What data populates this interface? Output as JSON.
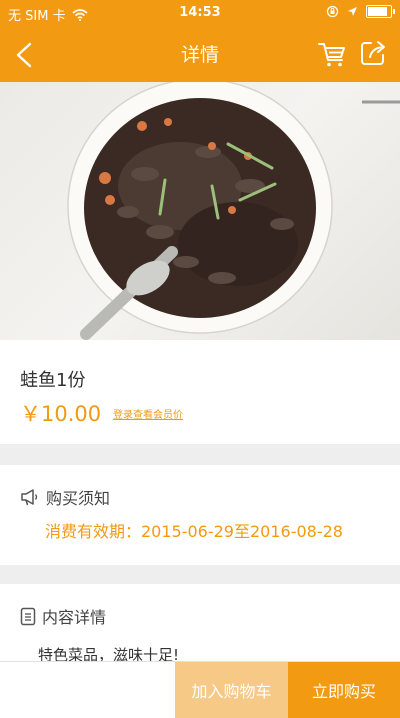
{
  "status_bar": {
    "carrier": "无 SIM 卡",
    "time": "14:53",
    "battery_level": 0.95
  },
  "nav": {
    "title": "详情"
  },
  "product": {
    "name": "蛙鱼1份",
    "price": "￥10.00",
    "member_price_link": "登录查看会员价"
  },
  "purchase_notice": {
    "title": "购买须知",
    "validity": "消费有效期：2015-06-29至2016-08-28"
  },
  "content_detail": {
    "title": "内容详情",
    "text": "特色菜品，滋味十足!"
  },
  "actions": {
    "add_to_cart": "加入购物车",
    "buy_now": "立即购买"
  },
  "colors": {
    "accent": "#f29a12",
    "accent_light": "#f6c986"
  },
  "icons": {
    "back": "back-icon",
    "cart": "cart-icon",
    "share": "share-icon",
    "megaphone": "megaphone-icon",
    "document": "document-icon"
  }
}
